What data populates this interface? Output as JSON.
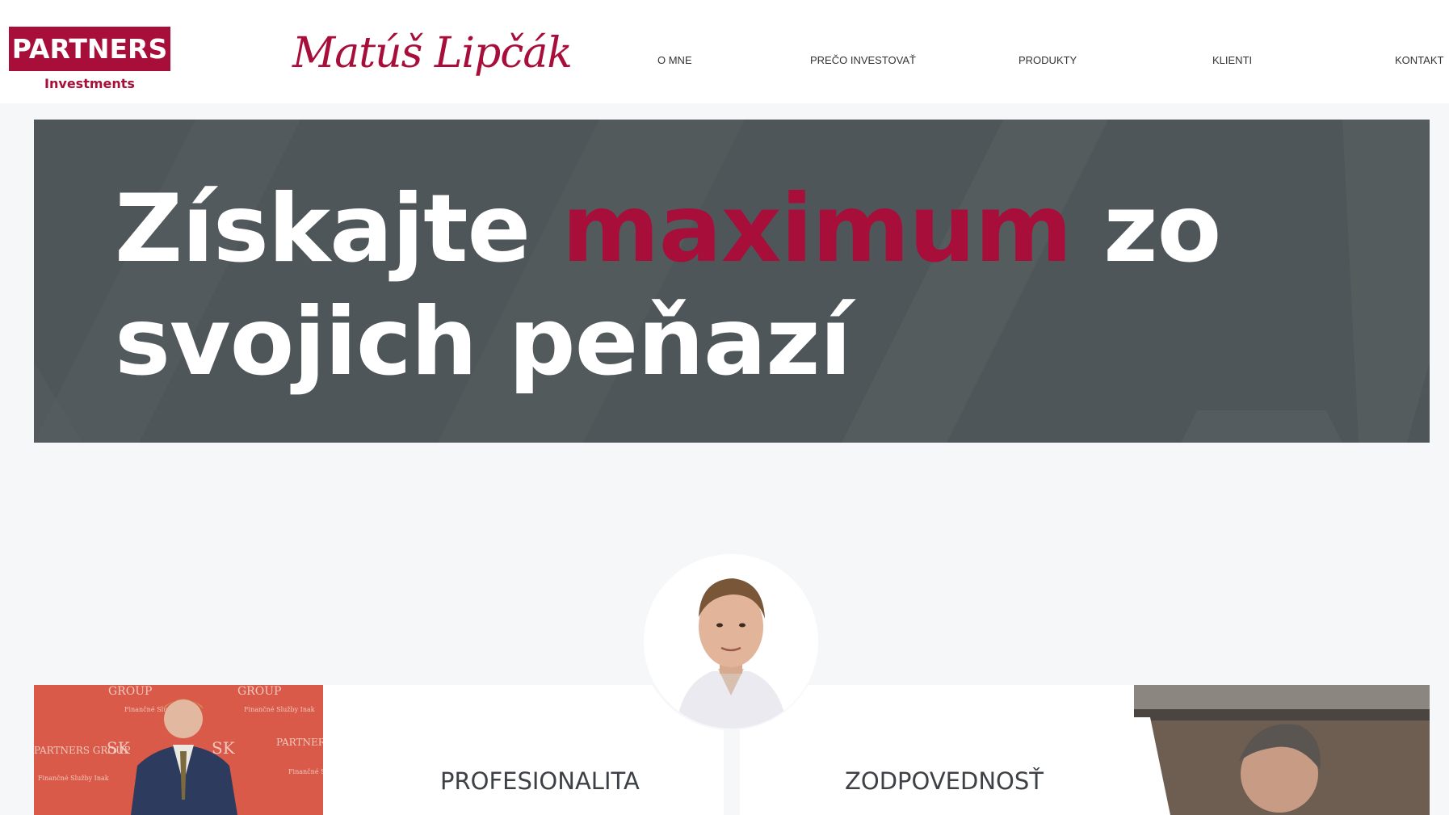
{
  "header": {
    "logo_text": "PARTNERS",
    "logo_sub": "Investments",
    "signature": "Matúš Lipčák",
    "nav": [
      "O MNE",
      "PREČO INVESTOVAŤ",
      "PRODUKTY",
      "KLIENTI",
      "KONTAKT"
    ]
  },
  "hero": {
    "title_part1": "Získajte ",
    "title_accent": "maximum",
    "title_part2": " zo",
    "title_line2": "svojich peňazí"
  },
  "cards": [
    {
      "label": "PROFESIONALITA"
    },
    {
      "label": "ZODPOVEDNOSŤ"
    }
  ],
  "photo_texts": {
    "group": "GROUP",
    "partners_group": "PARTNERS GROUP",
    "sk": "SK",
    "tagline": "Finančné Služby Inak"
  },
  "colors": {
    "brand": "#a80e3a",
    "hero_bg": "#4f5659",
    "page_bg": "#f6f7f9"
  }
}
